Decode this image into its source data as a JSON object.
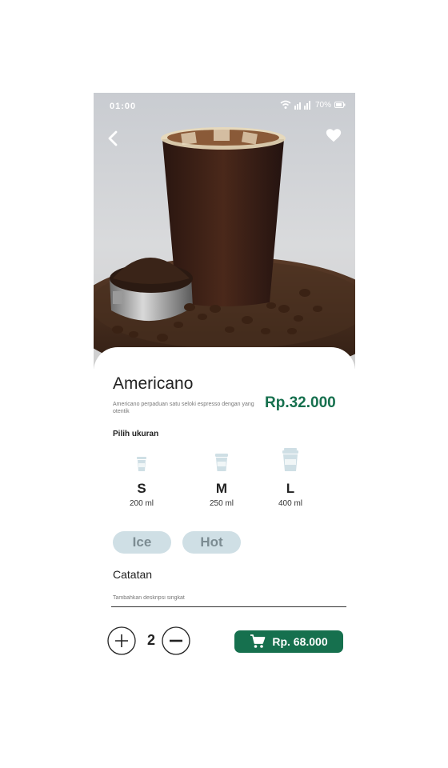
{
  "status_bar": {
    "time": "01:00",
    "battery": "70%"
  },
  "product": {
    "name": "Americano",
    "description": "Americano perpaduan satu seloki espresso dengan yang otentik",
    "price": "Rp.32.000"
  },
  "size_section": {
    "label": "Pilih ukuran",
    "options": [
      {
        "letter": "S",
        "volume": "200 ml"
      },
      {
        "letter": "M",
        "volume": "250 ml"
      },
      {
        "letter": "L",
        "volume": "400 ml"
      }
    ]
  },
  "temperature": {
    "ice": "Ice",
    "hot": "Hot"
  },
  "notes": {
    "label": "Catatan",
    "placeholder": "Tambahkan deskripsi singkat"
  },
  "order": {
    "quantity": "2",
    "cart_label": "Rp. 68.000"
  },
  "icons": [
    "back-icon",
    "heart-icon",
    "wifi-icon",
    "signal-icon",
    "battery-icon",
    "cup-icon",
    "plus-icon",
    "minus-icon",
    "cart-icon"
  ],
  "colors": {
    "accent": "#16704e",
    "chip": "#cfdfe5",
    "chip_text": "#7c8c92"
  }
}
